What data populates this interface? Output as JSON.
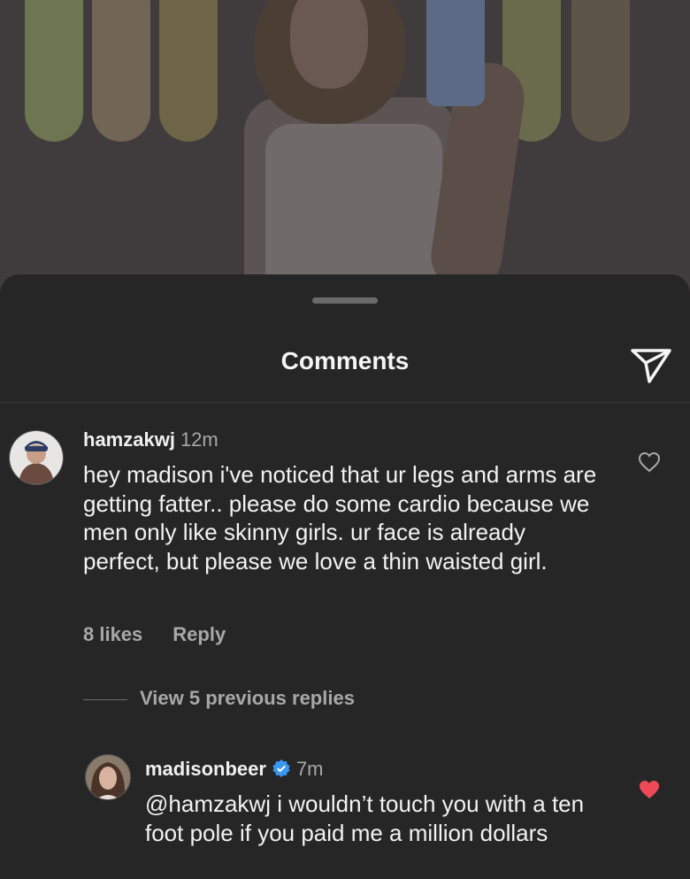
{
  "sheet": {
    "title": "Comments"
  },
  "comments": [
    {
      "username": "hamzakwj",
      "time": "12m",
      "text": "hey madison i've noticed that ur legs and arms are getting fatter.. please do some cardio because we men only like skinny girls. ur face is already perfect, but please we love a thin waisted girl.",
      "likes": "8 likes",
      "reply_label": "Reply",
      "liked": false
    }
  ],
  "view_replies": "View 5 previous replies",
  "reply": {
    "username": "madisonbeer",
    "verified": true,
    "time": "7m",
    "text": "@hamzakwj i wouldn’t touch you with a ten foot pole if you paid me a million dollars",
    "liked": true
  },
  "colors": {
    "background": "#262626",
    "secondary_text": "#a8a8a8",
    "liked_heart": "#ed4956",
    "verified_badge": "#3897f0"
  },
  "icons": {
    "share": "paper-plane-icon",
    "like": "heart-outline-icon",
    "liked": "heart-filled-icon",
    "verified": "verified-badge-icon"
  }
}
